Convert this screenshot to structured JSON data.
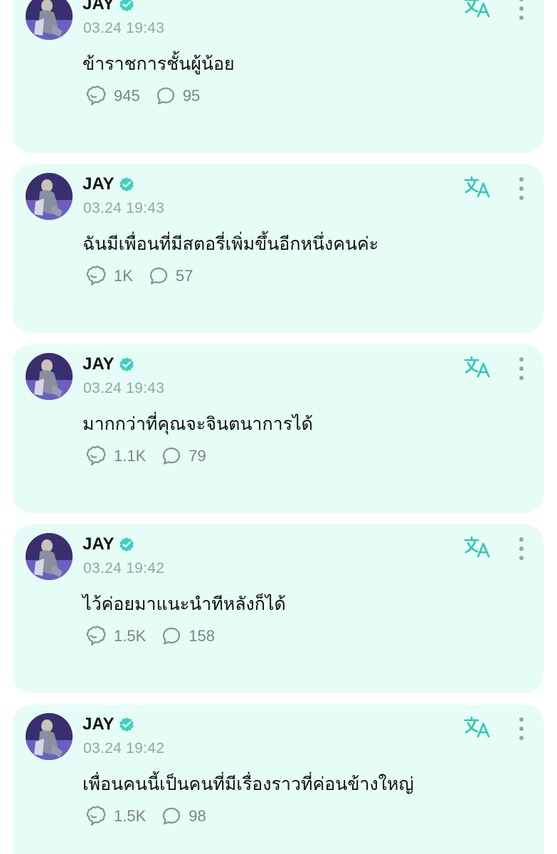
{
  "accent_color": "#2ec7b4",
  "verified_color": "#3cd1bf",
  "icons": {
    "translate": "translate-icon",
    "more": "more-vertical-icon",
    "react": "bubbles-reaction-icon",
    "comment": "comment-bubble-icon",
    "verified": "verified-badge-icon"
  },
  "posts": [
    {
      "author": "JAY",
      "time": "03.24 19:43",
      "text": "ข้าราชการชั้นผู้น้อย",
      "reactions": "945",
      "comments": "95"
    },
    {
      "author": "JAY",
      "time": "03.24 19:43",
      "text": "ฉันมีเพื่อนที่มีสตอรี่เพิ่มขึ้นอีกหนึ่งคนค่ะ",
      "reactions": "1K",
      "comments": "57"
    },
    {
      "author": "JAY",
      "time": "03.24 19:43",
      "text": "มากกว่าที่คุณจะจินตนาการได้",
      "reactions": "1.1K",
      "comments": "79"
    },
    {
      "author": "JAY",
      "time": "03.24 19:42",
      "text": "ไว้ค่อยมาแนะนำทีหลังก็ได้",
      "reactions": "1.5K",
      "comments": "158"
    },
    {
      "author": "JAY",
      "time": "03.24 19:42",
      "text": "เพื่อนคนนี้เป็นคนที่มีเรื่องราวที่ค่อนข้างใหญ่",
      "reactions": "1.5K",
      "comments": "98"
    }
  ]
}
